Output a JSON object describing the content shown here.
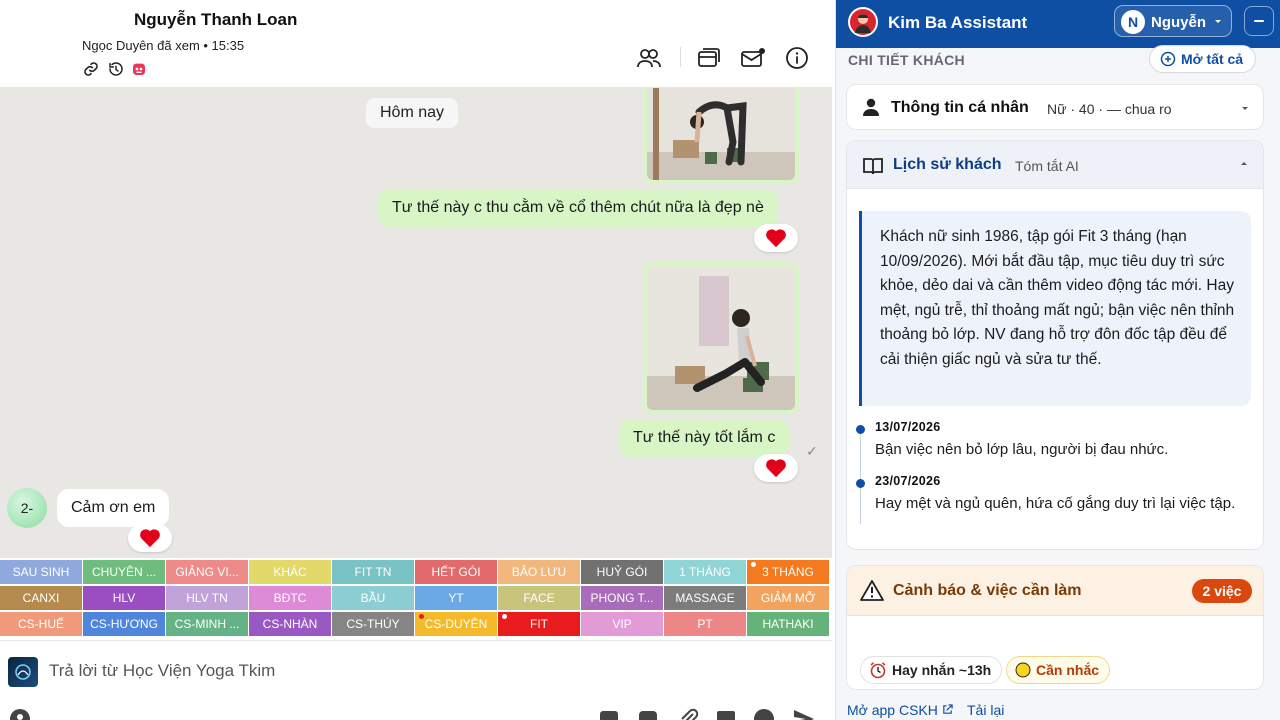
{
  "chat": {
    "contact_name": "Nguyễn Thanh Loan",
    "seen_status": "Ngọc Duyên đã xem • 15:35",
    "day_divider": "Hôm nay",
    "messages": [
      {
        "dir": "out",
        "text": "Tư thế này c thu cằm về cổ thêm chút nữa là đẹp nè",
        "reaction": "❤"
      },
      {
        "dir": "out",
        "text": "Tư thế này tốt lắm c",
        "reaction": "❤"
      },
      {
        "dir": "in",
        "text": "Cảm ơn em",
        "reaction": "❤",
        "avatar_label": "2-"
      }
    ]
  },
  "tags": [
    {
      "label": "SAU SINH",
      "color": "#8fa9df"
    },
    {
      "label": "CHUYÊN ...",
      "color": "#6ebd7e"
    },
    {
      "label": "GIẢNG VI...",
      "color": "#ef8a8a"
    },
    {
      "label": "KHÁC",
      "color": "#e3d86a"
    },
    {
      "label": "FIT TN",
      "color": "#79c3c6"
    },
    {
      "label": "HẾT GÓI",
      "color": "#e26a6a"
    },
    {
      "label": "BẢO LƯU",
      "color": "#f2b77d"
    },
    {
      "label": "HUỶ GÓI",
      "color": "#717171"
    },
    {
      "label": "1 THÁNG",
      "color": "#8fd5d6"
    },
    {
      "label": "3 THÁNG",
      "color": "#f5791f",
      "dot": "#fff"
    },
    {
      "label": "CANXI",
      "color": "#b58a4d"
    },
    {
      "label": "HLV",
      "color": "#9a4ec2"
    },
    {
      "label": "HLV TN",
      "color": "#c2a3d9"
    },
    {
      "label": "BĐTC",
      "color": "#dd8bd7"
    },
    {
      "label": "BẦU",
      "color": "#8bcdd2"
    },
    {
      "label": "YT",
      "color": "#6aa9e6"
    },
    {
      "label": "FACE",
      "color": "#c9c47c"
    },
    {
      "label": "PHONG T...",
      "color": "#a86cba"
    },
    {
      "label": "MASSAGE",
      "color": "#7c7c7c"
    },
    {
      "label": "GIẢM MỠ",
      "color": "#f2a45f"
    },
    {
      "label": "CS-HUẾ",
      "color": "#f09a7b"
    },
    {
      "label": "CS-HƯƠNG",
      "color": "#4f86db"
    },
    {
      "label": "CS-MINH ...",
      "color": "#65b286"
    },
    {
      "label": "CS-NHÀN",
      "color": "#9958c2"
    },
    {
      "label": "CS-THÚY",
      "color": "#858585"
    },
    {
      "label": "CS-DUYÊN",
      "color": "#f3bb2c",
      "dot": "#e81c1c"
    },
    {
      "label": "FIT",
      "color": "#e81c1c",
      "dot": "#fff"
    },
    {
      "label": "VIP",
      "color": "#e39bd8"
    },
    {
      "label": "PT",
      "color": "#ed8686"
    },
    {
      "label": "HATHAKI",
      "color": "#66b37a"
    }
  ],
  "reply": {
    "placeholder": "Trả lời từ Học Viện Yoga Tkim"
  },
  "assistant": {
    "title": "Kim Ba Assistant",
    "user_initial": "N",
    "user_name": "Nguyễn",
    "section_title": "CHI TIẾT KHÁCH",
    "open_all": "Mở tất cả",
    "personal": {
      "title": "Thông tin cá nhân",
      "summary": "Nữ · 40 · — chua ro"
    },
    "history": {
      "title": "Lịch sử khách",
      "subtitle": "Tóm tắt AI",
      "summary": "Khách nữ sinh 1986, tập gói Fit 3 tháng (hạn 10/09/2026). Mới bắt đầu tập, mục tiêu duy trì sức khỏe, dẻo dai và cần thêm video động tác mới. Hay mệt, ngủ trễ, thỉ thoảng mất ngủ; bận việc nên thỉnh thoảng bỏ lớp. NV đang hỗ trợ đôn đốc tập đều để cải thiện giấc ngủ và sửa tư thế.",
      "events": [
        {
          "date": "13/07/2026",
          "text": "Bận việc nên bỏ lớp lâu, người bị đau nhức."
        },
        {
          "date": "23/07/2026",
          "text": "Hay mệt và ngủ quên, hứa cố gắng duy trì lại việc tập."
        }
      ]
    },
    "warnings": {
      "title": "Cảnh báo & việc cần làm",
      "badge": "2 việc",
      "chips": [
        "Hay nhắn ~13h",
        "Cần nhắc"
      ]
    },
    "footer": {
      "open_app": "Mở app CSKH",
      "reload": "Tải lại"
    }
  },
  "colors": {
    "accent": "#0e4ea3",
    "bubble_out": "#d8f5c6",
    "chat_bg": "#e9e7e4",
    "warning": "#d9480f"
  }
}
